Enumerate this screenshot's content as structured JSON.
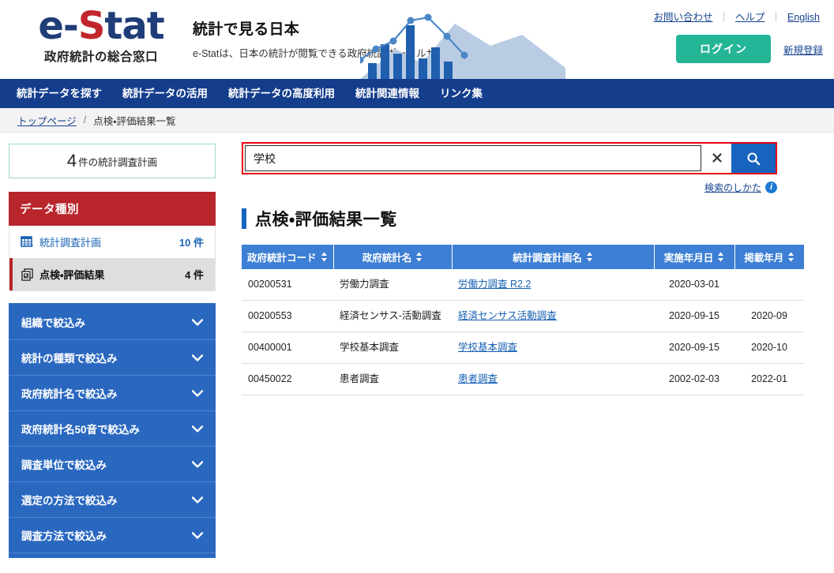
{
  "header": {
    "logo_main_pre": "e-",
    "logo_main_accent": "S",
    "logo_main_post": "tat",
    "logo_sub": "政府統計の総合窓口",
    "tagline_main": "統計で見る日本",
    "tagline_sub": "e-Statは、日本の統計が閲覧できる政府統計ポータルサイトです",
    "links": [
      {
        "label": "お問い合わせ",
        "name": "contact-link"
      },
      {
        "label": "ヘルプ",
        "name": "help-link"
      },
      {
        "label": "English",
        "name": "english-link"
      }
    ],
    "separator": "｜",
    "login_label": "ログイン",
    "register_label": "新規登録",
    "login_color": "#24b597"
  },
  "gnav": {
    "items": [
      {
        "label": "統計データを探す",
        "name": "gnav-find-data"
      },
      {
        "label": "統計データの活用",
        "name": "gnav-use-data"
      },
      {
        "label": "統計データの高度利用",
        "name": "gnav-advanced-data"
      },
      {
        "label": "統計関連情報",
        "name": "gnav-related-info"
      },
      {
        "label": "リンク集",
        "name": "gnav-links"
      }
    ],
    "bg_color": "#143d8c"
  },
  "breadcrumb": {
    "home": "トップページ",
    "separator": "/",
    "current": "点検・評価結果一覧"
  },
  "sidebar": {
    "count_box": {
      "number": "4",
      "label": "件の統計調査計画"
    },
    "panel_title": "データ種別",
    "panel_color": "#b8252b",
    "types": [
      {
        "label": "統計調査計画",
        "count": "10 件",
        "icon": "table-grid-icon",
        "selected": false
      },
      {
        "label": "点検・評価結果",
        "count": "4 件",
        "icon": "documents-stack-icon",
        "selected": true
      }
    ],
    "filters": [
      {
        "label": "組織で絞込み",
        "name": "filter-organization"
      },
      {
        "label": "統計の種類で絞込み",
        "name": "filter-statistic-type"
      },
      {
        "label": "政府統計名で絞込み",
        "name": "filter-gov-statistic-name"
      },
      {
        "label": "政府統計名50音で絞込み",
        "name": "filter-gov-statistic-kana"
      },
      {
        "label": "調査単位で絞込み",
        "name": "filter-survey-unit"
      },
      {
        "label": "選定の方法で絞込み",
        "name": "filter-selection-method"
      },
      {
        "label": "調査方法で絞込み",
        "name": "filter-survey-method"
      }
    ],
    "filters_bg": "#2a68c0"
  },
  "search": {
    "value": "学校",
    "placeholder": "",
    "clear_icon": "close-x-icon",
    "search_icon": "magnifier-icon",
    "howto_label": "検索のしかた",
    "info_icon": "info-circle-icon",
    "highlight_color": "#e60012"
  },
  "main": {
    "page_title": "点検・評価結果一覧",
    "title_bar_color": "#1764c0"
  },
  "table": {
    "columns": [
      {
        "label": "政府統計コード",
        "name": "col-gov-stat-code",
        "sortable": true
      },
      {
        "label": "政府統計名",
        "name": "col-gov-stat-name",
        "sortable": true
      },
      {
        "label": "統計調査計画名",
        "name": "col-survey-plan-name",
        "sortable": true
      },
      {
        "label": "実施年月日",
        "name": "col-implementation-date",
        "sortable": true
      },
      {
        "label": "掲載年月",
        "name": "col-publication-date",
        "sortable": true
      }
    ],
    "rows": [
      {
        "code": "00200531",
        "stat_name": "労働力調査",
        "plan_name": "労働力調査 R2.2",
        "impl_date": "2020-03-01",
        "pub_date": ""
      },
      {
        "code": "00200553",
        "stat_name": "経済センサス-活動調査",
        "plan_name": "経済センサス活動調査",
        "impl_date": "2020-09-15",
        "pub_date": "2020-09"
      },
      {
        "code": "00400001",
        "stat_name": "学校基本調査",
        "plan_name": "学校基本調査",
        "impl_date": "2020-09-15",
        "pub_date": "2020-10"
      },
      {
        "code": "00450022",
        "stat_name": "患者調査",
        "plan_name": "患者調査",
        "impl_date": "2002-02-03",
        "pub_date": "2022-01"
      }
    ],
    "header_color": "#3d7fd4"
  }
}
